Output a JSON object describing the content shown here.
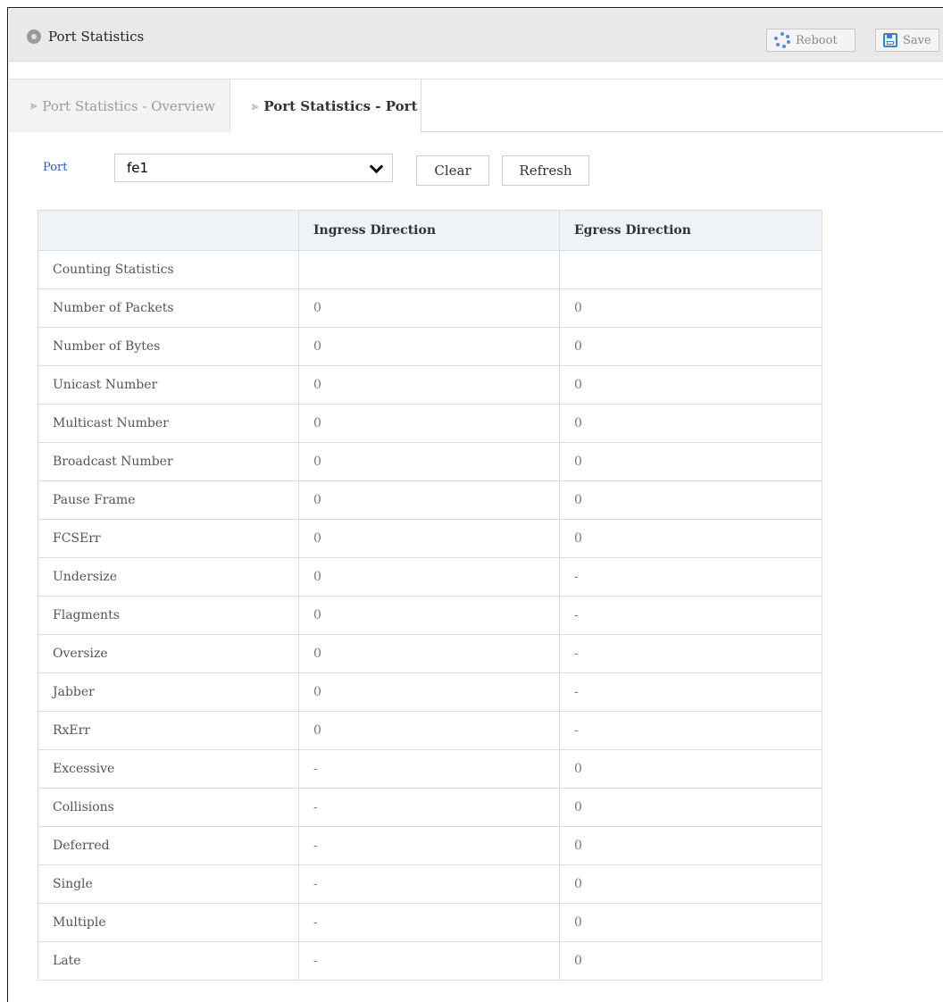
{
  "header": {
    "title": "Port Statistics",
    "reboot_label": "Reboot",
    "save_label": "Save"
  },
  "tabs": [
    {
      "label": "Port Statistics - Overview",
      "active": false
    },
    {
      "label": "Port Statistics - Port",
      "active": true
    }
  ],
  "controls": {
    "port_label": "Port",
    "port_value": "fe1",
    "clear_label": "Clear",
    "refresh_label": "Refresh"
  },
  "table": {
    "headers": [
      "",
      "Ingress Direction",
      "Egress Direction"
    ],
    "rows": [
      [
        "Counting Statistics",
        "",
        ""
      ],
      [
        "Number of Packets",
        "0",
        "0"
      ],
      [
        "Number of Bytes",
        "0",
        "0"
      ],
      [
        "Unicast Number",
        "0",
        "0"
      ],
      [
        "Multicast Number",
        "0",
        "0"
      ],
      [
        "Broadcast Number",
        "0",
        "0"
      ],
      [
        "Pause Frame",
        "0",
        "0"
      ],
      [
        "FCSErr",
        "0",
        "0"
      ],
      [
        "Undersize",
        "0",
        "-"
      ],
      [
        "Flagments",
        "0",
        "-"
      ],
      [
        "Oversize",
        "0",
        "-"
      ],
      [
        "Jabber",
        "0",
        "-"
      ],
      [
        "RxErr",
        "0",
        "-"
      ],
      [
        "Excessive",
        "-",
        "0"
      ],
      [
        "Collisions",
        "-",
        "0"
      ],
      [
        "Deferred",
        "-",
        "0"
      ],
      [
        "Single",
        "-",
        "0"
      ],
      [
        "Multiple",
        "-",
        "0"
      ],
      [
        "Late",
        "-",
        "0"
      ]
    ]
  },
  "icons": {
    "title": "circle-icon",
    "reboot": "spinner-icon",
    "save": "floppy-disk-icon",
    "tab": "chevron-right-icon",
    "select": "chevron-down-icon"
  },
  "colors": {
    "titlebar_bg": "#e9e9e9",
    "table_header_bg": "#eef3f8",
    "port_label": "#2a5db0",
    "icon_blue": "#4a90d9"
  }
}
